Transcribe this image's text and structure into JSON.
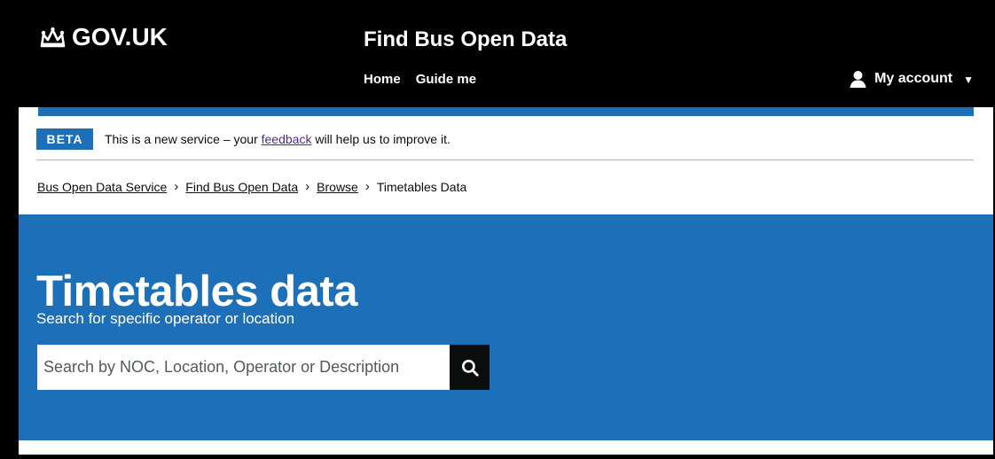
{
  "header": {
    "logo_text": "GOV.UK",
    "service_name": "Find Bus Open Data",
    "nav": [
      {
        "label": "Home"
      },
      {
        "label": "Guide me"
      }
    ],
    "account_label": "My account"
  },
  "phase_banner": {
    "tag": "BETA",
    "text_before": "This is a new service – your ",
    "link_text": "feedback",
    "text_after": " will help us to improve it."
  },
  "breadcrumbs": [
    {
      "label": "Bus Open Data Service",
      "link": true
    },
    {
      "label": "Find Bus Open Data",
      "link": true
    },
    {
      "label": "Browse",
      "link": true
    },
    {
      "label": "Timetables Data",
      "link": false
    }
  ],
  "hero": {
    "title": "Timetables data",
    "search_label": "Search for specific operator or location",
    "search_placeholder": "Search by NOC, Location, Operator or Description",
    "search_value": ""
  },
  "icons": {
    "logo": "crown-icon",
    "account": "user-icon",
    "account_menu": "caret-down-icon",
    "search": "search-icon"
  },
  "colors": {
    "header_background": "#000000",
    "brand_blue": "#1d70b8",
    "text": "#0b0c0c",
    "feedback_link": "#4c2c92",
    "search_button": "#0b0c0c"
  }
}
